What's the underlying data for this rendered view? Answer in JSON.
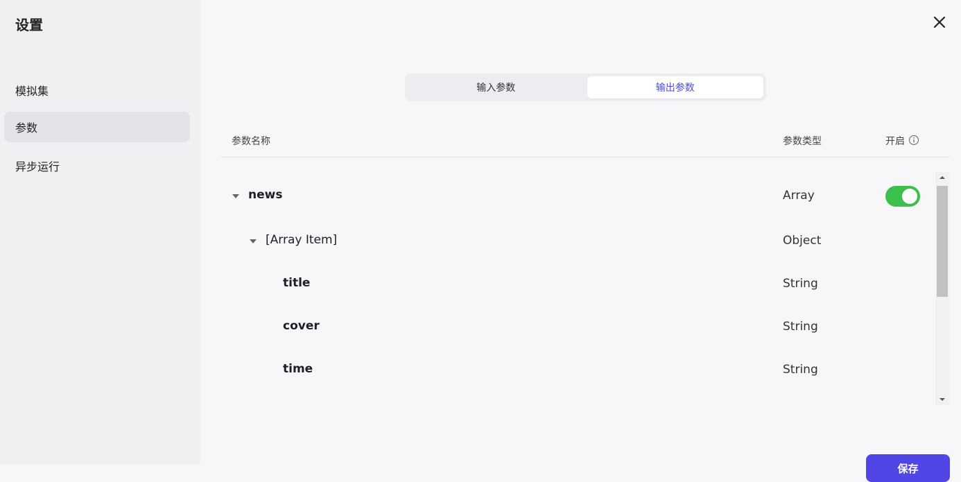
{
  "sidebar": {
    "title": "设置",
    "items": [
      {
        "label": "模拟集"
      },
      {
        "label": "参数",
        "active": true
      },
      {
        "label": "异步运行"
      }
    ]
  },
  "tabs": [
    {
      "label": "输入参数",
      "active": false
    },
    {
      "label": "输出参数",
      "active": true
    }
  ],
  "table": {
    "columns": {
      "name": "参数名称",
      "type": "参数类型",
      "enabled": "开启"
    },
    "rows": [
      {
        "name": "news",
        "type": "Array",
        "expanded": true,
        "enabled": true
      },
      {
        "name": "[Array Item]",
        "type": "Object",
        "expanded": true
      },
      {
        "name": "title",
        "type": "String"
      },
      {
        "name": "cover",
        "type": "String"
      },
      {
        "name": "time",
        "type": "String"
      }
    ]
  },
  "footer": {
    "save_label": "保存"
  },
  "colors": {
    "accent": "#4f46e5",
    "toggle_on": "#3cbf4d",
    "tab_active_text": "#4c4ce6"
  },
  "icons": {
    "close": "close-icon",
    "info": "info-icon",
    "caret": "caret-down-icon"
  }
}
